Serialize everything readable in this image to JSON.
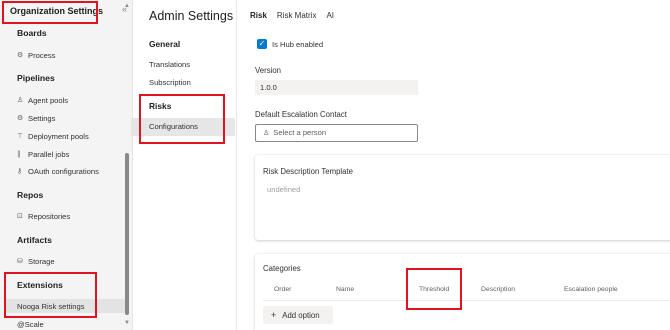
{
  "org_settings": "Organization Settings",
  "leftnav": {
    "boards": {
      "title": "Boards",
      "items": [
        {
          "label": "Process"
        }
      ]
    },
    "pipelines": {
      "title": "Pipelines",
      "items": [
        {
          "label": "Agent pools"
        },
        {
          "label": "Settings"
        },
        {
          "label": "Deployment pools"
        },
        {
          "label": "Parallel jobs"
        },
        {
          "label": "OAuth configurations"
        }
      ]
    },
    "repos": {
      "title": "Repos",
      "items": [
        {
          "label": "Repositories"
        }
      ]
    },
    "artifacts": {
      "title": "Artifacts",
      "items": [
        {
          "label": "Storage"
        }
      ]
    },
    "extensions": {
      "title": "Extensions",
      "items": [
        {
          "label": "Nooga Risk settings"
        },
        {
          "label": "@Scale"
        }
      ]
    }
  },
  "admin": {
    "title": "Admin Settings",
    "general": {
      "title": "General",
      "items": [
        {
          "label": "Translations"
        },
        {
          "label": "Subscription"
        }
      ]
    },
    "risks": {
      "title": "Risks",
      "items": [
        {
          "label": "Configurations"
        }
      ]
    }
  },
  "tabs": [
    {
      "label": "Risk"
    },
    {
      "label": "Risk Matrix"
    },
    {
      "label": "AI"
    }
  ],
  "form": {
    "hub_enabled_label": "Is Hub enabled",
    "hub_enabled": true,
    "version_label": "Version",
    "version_value": "1.0.0",
    "escalation_label": "Default Escalation Contact",
    "escalation_placeholder": "Select a person",
    "template_label": "Risk Description Template",
    "template_value": "undefined",
    "categories_label": "Categories",
    "columns": [
      "Order",
      "Name",
      "Threshold",
      "Description",
      "Escalation people"
    ],
    "add_option": "Add option"
  },
  "colors": {
    "accent": "#0078d4",
    "highlight": "#e0141e"
  }
}
